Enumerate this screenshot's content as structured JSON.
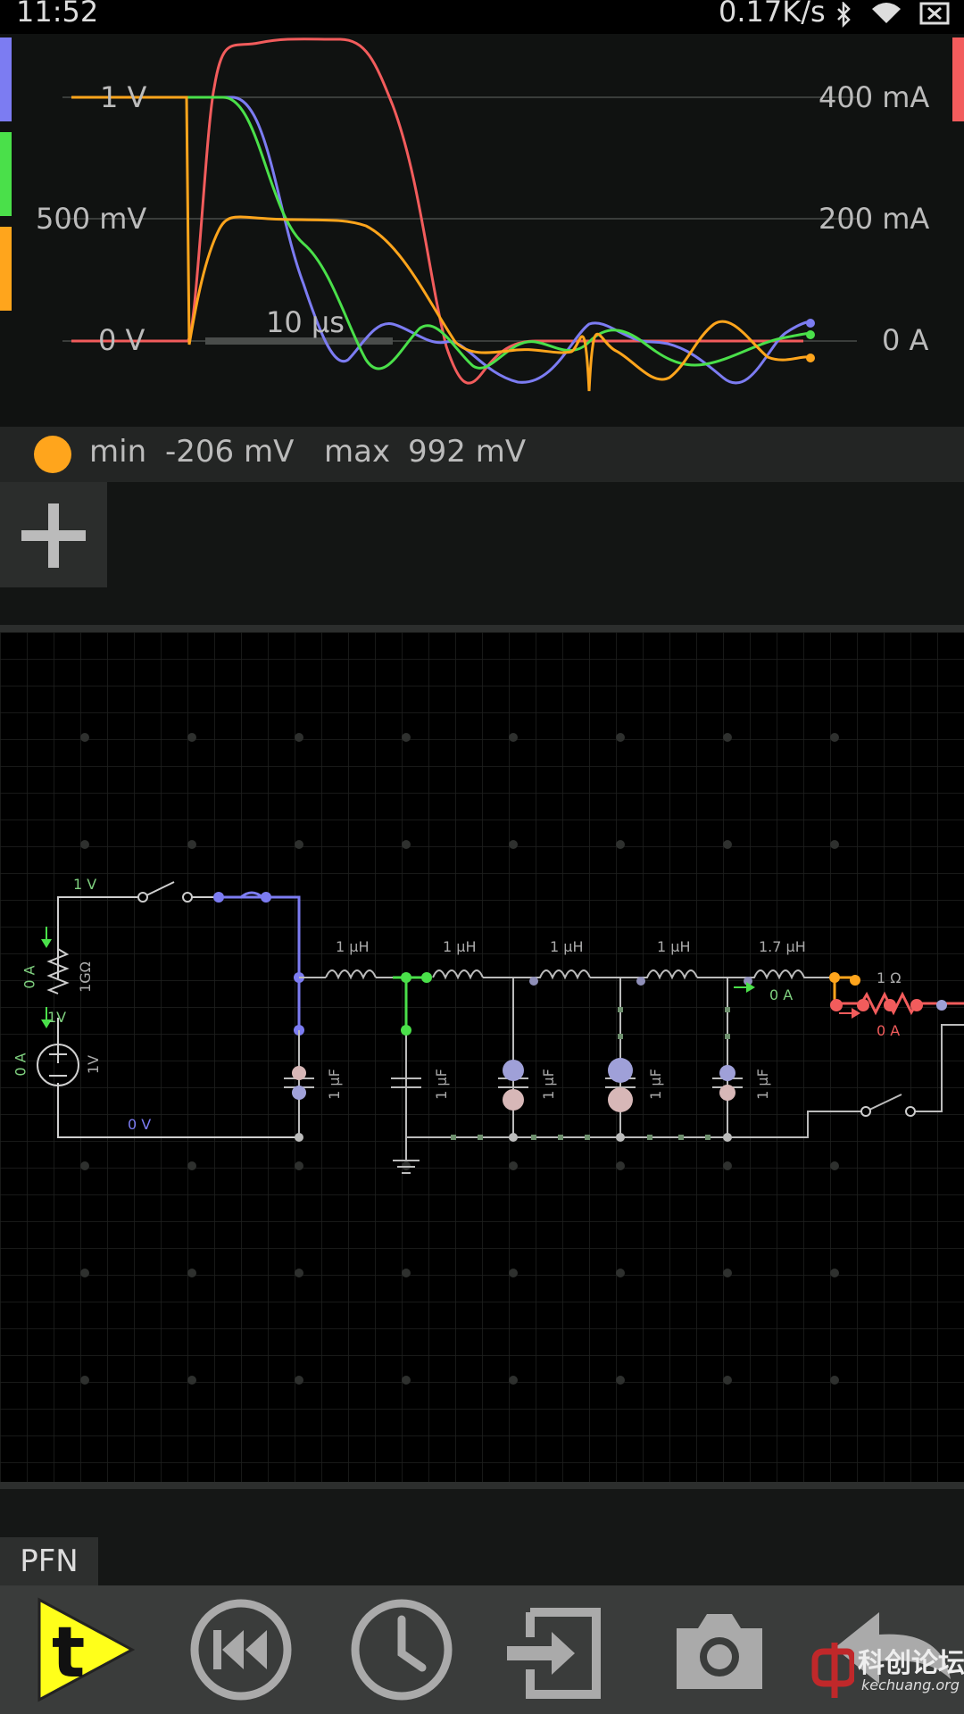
{
  "status_bar": {
    "time": "11:52",
    "net_speed": "0.17K/s",
    "icons": [
      "bluetooth-icon",
      "wifi-icon",
      "close-box-icon"
    ]
  },
  "scope": {
    "y_left_labels": [
      "1 V",
      "500 mV",
      "0 V"
    ],
    "y_right_labels": [
      "400 mA",
      "200 mA",
      "0 A"
    ],
    "time_label": "10 µs",
    "trace_colors": {
      "blue": "#7c7cf2",
      "green": "#4ae04a",
      "orange": "#ffa51c",
      "red": "#f25c5c"
    }
  },
  "readout": {
    "min_label": "min",
    "min_value": "-206 mV",
    "max_label": "max",
    "max_value": "992 mV"
  },
  "circuit": {
    "labels": {
      "src_top": "1 V",
      "src_current": "0 A",
      "res_value": "1GΩ",
      "res_bottom": "1V",
      "bat_current": "0 A",
      "bat_value": "1V",
      "ground_line": "0 V",
      "ind1": "1 µH",
      "ind2": "1 µH",
      "ind3": "1 µH",
      "ind4": "1 µH",
      "ind5": "1.7 µH",
      "ind5_current": "0 A",
      "load_res": "1 Ω",
      "load_current": "0 A",
      "cap1": "1 µF",
      "cap2": "1 µF",
      "cap3": "1 µF",
      "cap4": "1 µF",
      "cap5": "1 µF"
    }
  },
  "tab": {
    "label": "PFN"
  },
  "toolbar": {
    "tools": [
      "play-t-icon",
      "rewind-icon",
      "clock-icon",
      "export-icon",
      "camera-icon",
      "undo-icon"
    ]
  },
  "watermark": {
    "line1": "科创论坛",
    "line2": "kechuang.org"
  }
}
